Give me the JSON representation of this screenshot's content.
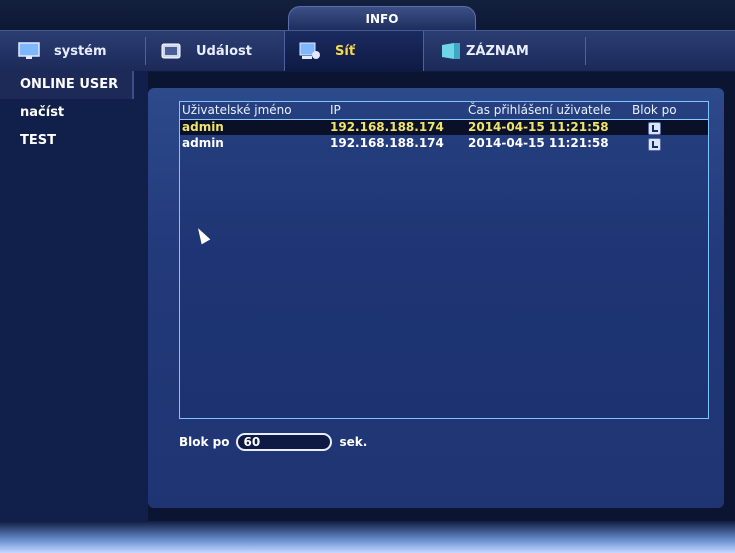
{
  "window": {
    "title": "INFO"
  },
  "tabs": [
    {
      "label": "systém",
      "icon": "monitor-icon",
      "active": false
    },
    {
      "label": "Událost",
      "icon": "event-icon",
      "active": false
    },
    {
      "label": "Síť",
      "icon": "network-icon",
      "active": true
    },
    {
      "label": "ZÁZNAM",
      "icon": "record-icon",
      "active": false
    }
  ],
  "sidebar": {
    "items": [
      {
        "label": "ONLINE USER",
        "active": true
      },
      {
        "label": "načíst",
        "active": false
      },
      {
        "label": "TEST",
        "active": false
      }
    ]
  },
  "table": {
    "headers": [
      "Uživatelské jméno",
      "IP",
      "Čas přihlášení uživatele",
      "Blok po"
    ],
    "rows": [
      {
        "user": "admin",
        "ip": "192.168.188.174",
        "time": "2014-04-15 11:21:58",
        "block_icon": "block-user-icon"
      },
      {
        "user": "admin",
        "ip": "192.168.188.174",
        "time": "2014-04-15 11:21:58",
        "block_icon": "block-user-icon"
      }
    ]
  },
  "block_after": {
    "label": "Blok po",
    "value": "60",
    "unit": "sek."
  },
  "colors": {
    "accent_active_tab": "#f7d84a",
    "grid_border": "#7fc4ff",
    "panel_bg": "#22397a"
  }
}
